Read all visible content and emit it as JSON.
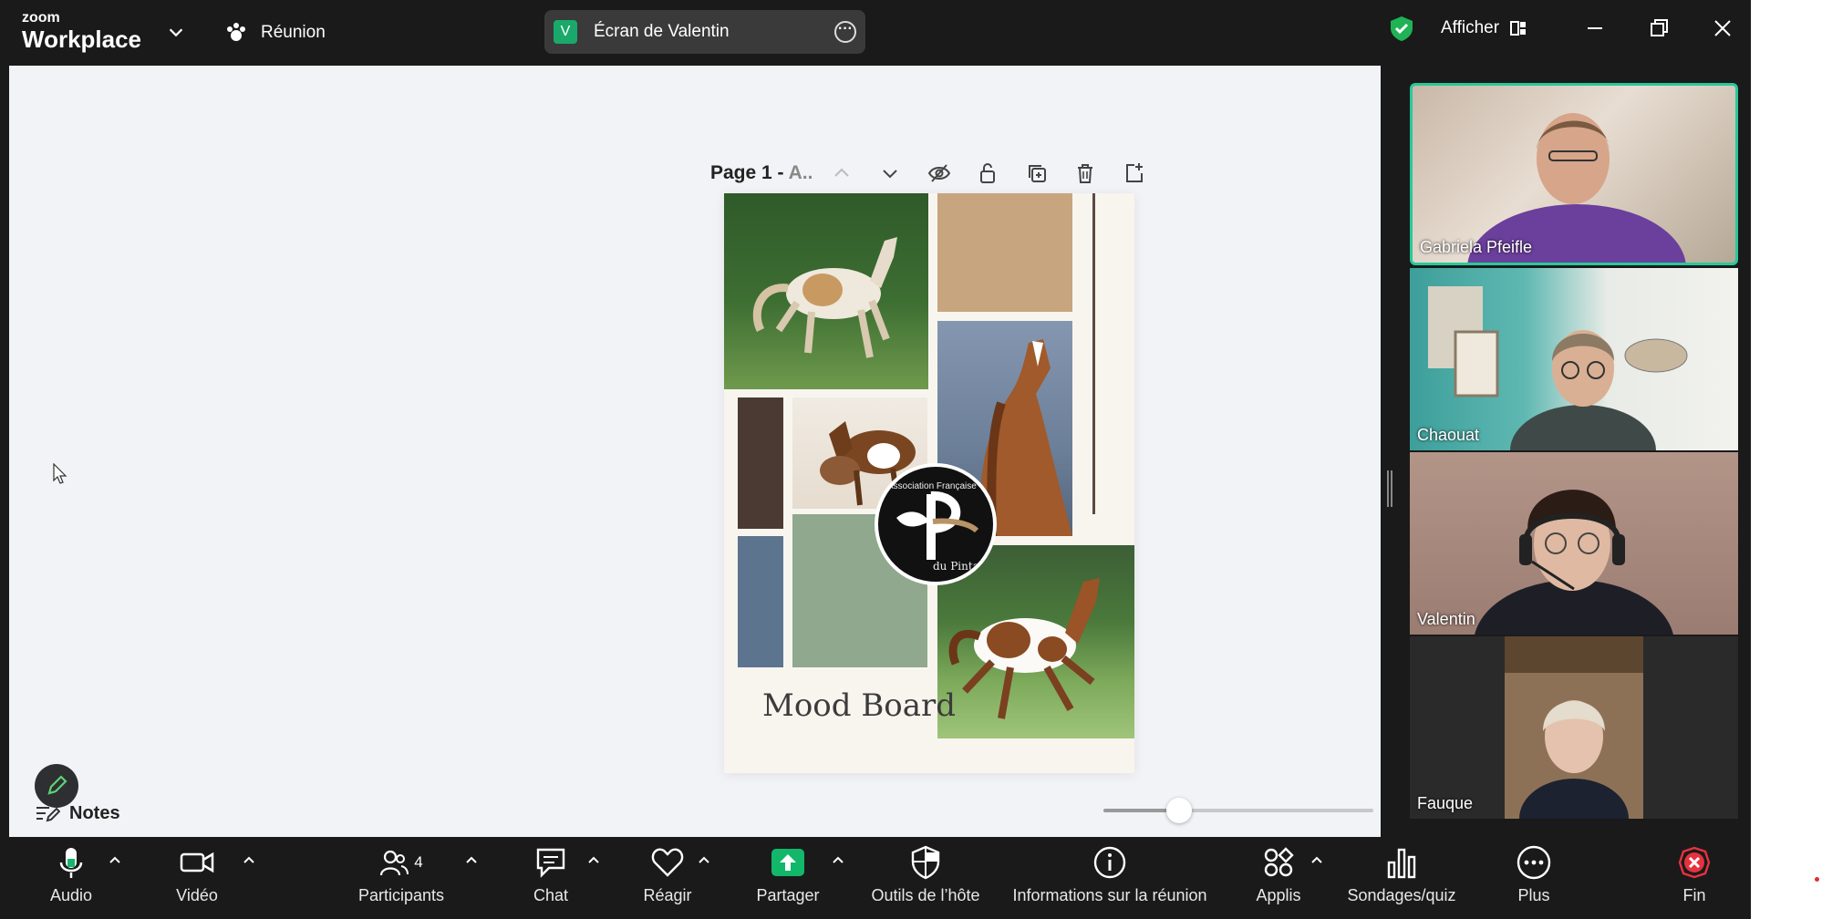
{
  "topbar": {
    "logo_small": "zoom",
    "logo_big": "Workplace",
    "meeting_label": "Réunion",
    "share_initial": "V",
    "share_title": "Écran de Valentin",
    "view_label": "Afficher",
    "shield_color": "#1fb356"
  },
  "shared": {
    "page_title": "Page 1 - ",
    "page_title_dim": "A..",
    "mood_title": "Mood Board",
    "logo_top": "Association Française",
    "logo_bottom": "du Pintado",
    "swatches": {
      "tan": "#c7a57f",
      "dark_brown": "#4a3a33",
      "slate_blue": "#5d748e",
      "sage": "#8fa88e"
    },
    "notes_label": "Notes",
    "zoom_level": 0.28
  },
  "participants": [
    {
      "name": "Gabriela Pfeifle",
      "active": true
    },
    {
      "name": "Chaouat",
      "active": false
    },
    {
      "name": "Valentin",
      "active": false
    },
    {
      "name": "Fauque",
      "active": false
    }
  ],
  "toolbar": {
    "audio": "Audio",
    "video": "Vidéo",
    "participants": "Participants",
    "participants_count": "4",
    "chat": "Chat",
    "react": "Réagir",
    "share": "Partager",
    "host_tools": "Outils de l’hôte",
    "meeting_info": "Informations sur la réunion",
    "apps": "Applis",
    "polls": "Sondages/quiz",
    "more": "Plus",
    "end": "Fin",
    "accent_green": "#12b76a",
    "end_red": "#e5323f"
  }
}
